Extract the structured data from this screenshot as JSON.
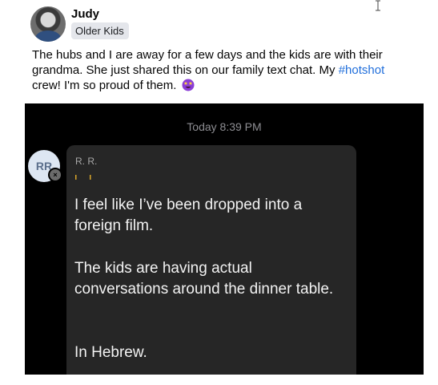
{
  "post": {
    "author": "Judy",
    "group": "Older Kids",
    "text_before": "The hubs and I are away for a few days and the kids are with their grandma. She just shared this on our family text chat. My ",
    "hashtag": "#hotshot",
    "text_after": " crew! I'm so proud of them.",
    "emoji": "star-struck-emoji-icon"
  },
  "chat": {
    "timestamp": "Today 8:39 PM",
    "sender_initials": "RR",
    "sender_name": "R. R.",
    "messages": [
      "I feel like I’ve been dropped into a foreign film.",
      "The kids are having actual conversations around the dinner table.",
      "In Hebrew."
    ]
  },
  "colors": {
    "hashtag": "#216fdb",
    "chat_bg": "#000000",
    "bubble_bg": "#262626",
    "emoji": "#8a3dd6"
  }
}
